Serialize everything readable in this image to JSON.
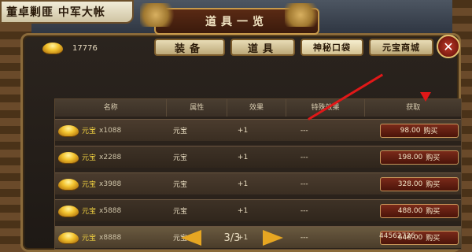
{
  "hud": {
    "title": "董卓剿匪 中军大帐"
  },
  "window": {
    "title": "道具一览",
    "gold_amount": "17776",
    "tabs": [
      {
        "label": "装备",
        "active": false
      },
      {
        "label": "道具",
        "active": false
      },
      {
        "label": "神秘口袋",
        "active": true
      },
      {
        "label": "元宝商城",
        "active": false
      }
    ],
    "close_label": "✕"
  },
  "table": {
    "headers": [
      "名称",
      "属性",
      "效果",
      "特殊效果",
      "获取"
    ],
    "rows": [
      {
        "name": "元宝",
        "qty": "x1088",
        "attr": "元宝",
        "effect": "+1",
        "special": "---",
        "price": "98.00",
        "buy": "购买"
      },
      {
        "name": "元宝",
        "qty": "x2288",
        "attr": "元宝",
        "effect": "+1",
        "special": "---",
        "price": "198.00",
        "buy": "购买"
      },
      {
        "name": "元宝",
        "qty": "x3988",
        "attr": "元宝",
        "effect": "+1",
        "special": "---",
        "price": "328.00",
        "buy": "购买"
      },
      {
        "name": "元宝",
        "qty": "x5888",
        "attr": "元宝",
        "effect": "+1",
        "special": "---",
        "price": "488.00",
        "buy": "购买"
      },
      {
        "name": "元宝",
        "qty": "x8888",
        "attr": "元宝",
        "effect": "+1",
        "special": "---",
        "price": "648.00",
        "buy": "购买"
      }
    ]
  },
  "pager": {
    "page": "3/3"
  },
  "footer": {
    "total": "44562726"
  },
  "colors": {
    "accent": "#e6a622",
    "annotation": "#e01818"
  }
}
